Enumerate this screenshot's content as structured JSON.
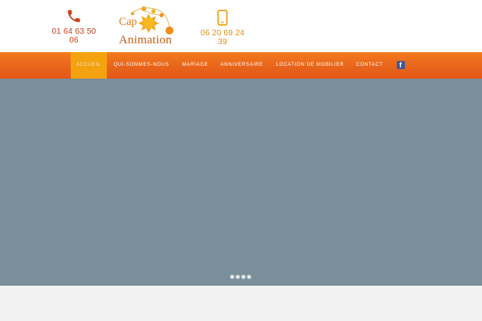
{
  "header": {
    "phone_left": [
      "01 64 63 50",
      "06"
    ],
    "phone_right": [
      "06 20 69 24",
      "39"
    ],
    "logo": {
      "line1": "Cap",
      "line2": "Animation"
    }
  },
  "nav": {
    "items": [
      {
        "label": "Accueil",
        "active": true
      },
      {
        "label": "Qui-sommes-nous",
        "active": false
      },
      {
        "label": "Mariage",
        "active": false
      },
      {
        "label": "Anniversaire",
        "active": false
      },
      {
        "label": "Location de mobilier",
        "active": false
      },
      {
        "label": "Contact",
        "active": false
      }
    ],
    "social": {
      "icon": "facebook-icon",
      "glyph": "f"
    }
  },
  "slider": {
    "dots_count": 4
  },
  "colors": {
    "nav_orange": "#e8631a",
    "active_item": "#f4a210",
    "phone_red": "#c8401a",
    "accent_orange": "#e58f12",
    "slider_bg": "#7a8f9a"
  }
}
